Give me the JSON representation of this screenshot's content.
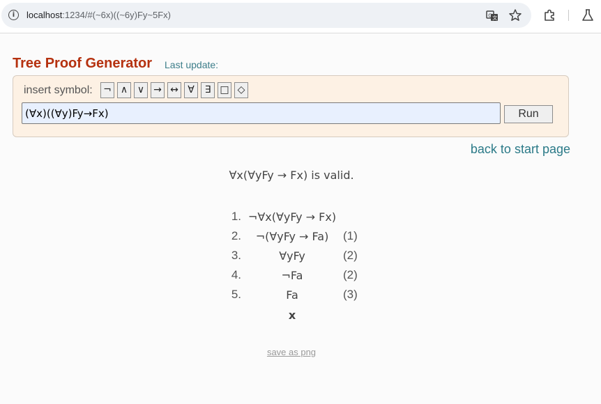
{
  "browser": {
    "url_host": "localhost",
    "url_rest": ":1234/#(~6x)((~6y)Fy~5Fx)",
    "icons": [
      "info-icon",
      "translate-icon",
      "star-icon",
      "extensions-icon",
      "labs-flask-icon"
    ]
  },
  "page": {
    "title": "Tree Proof Generator",
    "last_update": "Last update:"
  },
  "input_panel": {
    "insert_label": "insert symbol:",
    "symbols": [
      "¬",
      "∧",
      "∨",
      "→",
      "↔",
      "∀",
      "∃",
      "□",
      "◇"
    ],
    "formula_value": "(∀x)((∀y)Fy→Fx)",
    "run_label": "Run"
  },
  "nav": {
    "back_link": "back to start page"
  },
  "result": {
    "text": "∀x(∀yFy → Fx) is valid."
  },
  "proof": {
    "lines": [
      {
        "num": "1.",
        "formula": "¬∀x(∀yFy → Fx)",
        "just": ""
      },
      {
        "num": "2.",
        "formula": "¬(∀yFy → Fa)",
        "just": "(1)"
      },
      {
        "num": "3.",
        "formula": "∀yFy",
        "just": "(2)"
      },
      {
        "num": "4.",
        "formula": "¬Fa",
        "just": "(2)"
      },
      {
        "num": "5.",
        "formula": "Fa",
        "just": "(3)"
      }
    ],
    "closed_marker": "x"
  },
  "footer": {
    "save_link": "save as png"
  }
}
